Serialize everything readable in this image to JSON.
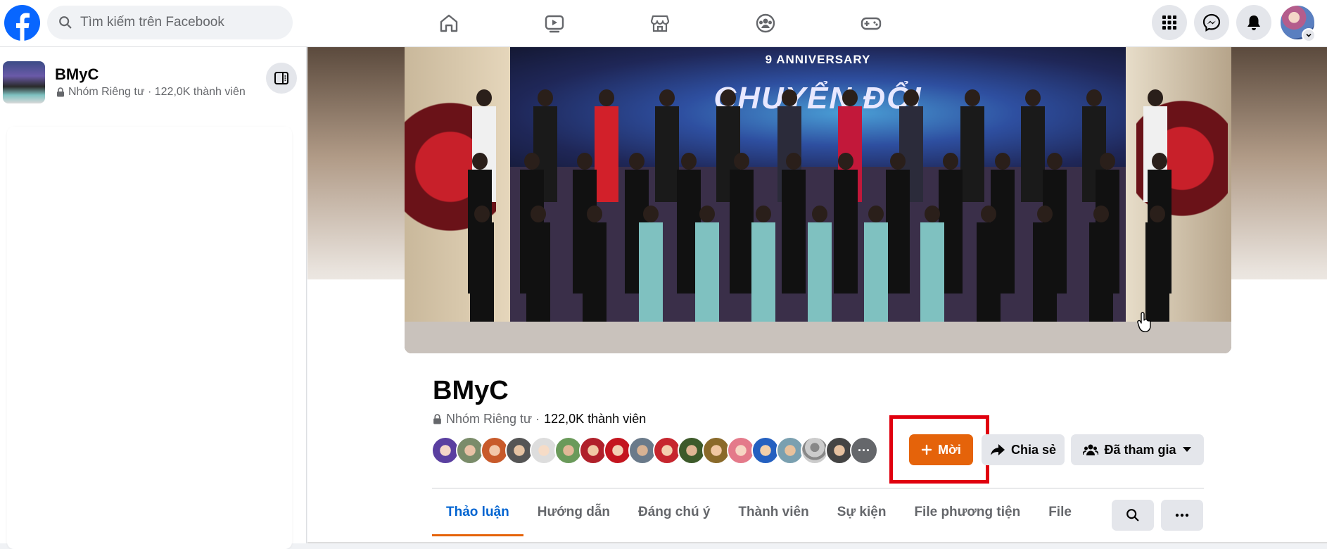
{
  "topbar": {
    "search_placeholder": "Tìm kiếm trên Facebook",
    "nav_tabs": [
      "home-icon",
      "video-icon",
      "marketplace-icon",
      "groups-icon",
      "gaming-icon"
    ],
    "right_buttons": [
      "menu-grid-icon",
      "messenger-icon",
      "bell-icon"
    ]
  },
  "sidebar": {
    "group_name": "BMyC",
    "group_meta": "Nhóm Riêng tư · 122,0K thành viên"
  },
  "cover": {
    "anniversary": "9 ANNIVERSARY",
    "headline": "CHUYỂN ĐỔI"
  },
  "group": {
    "title": "BMyC",
    "privacy": "Nhóm Riêng tư ·",
    "members": "122,0K thành viên"
  },
  "actions": {
    "invite": "Mời",
    "share": "Chia sẻ",
    "joined": "Đã tham gia"
  },
  "tabs": [
    "Thảo luận",
    "Hướng dẫn",
    "Đáng chú ý",
    "Thành viên",
    "Sự kiện",
    "File phương tiện",
    "File"
  ],
  "colors": {
    "accent": "#e5630a",
    "brand": "#0866ff",
    "active_tab_text": "#0064d1",
    "highlight_box": "#e0000e"
  }
}
